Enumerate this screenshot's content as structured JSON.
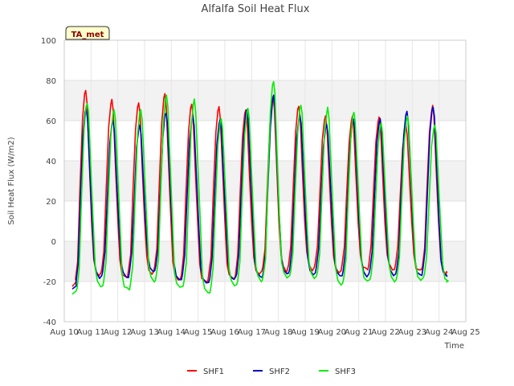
{
  "chart_data": {
    "type": "line",
    "title": "Alfalfa Soil Heat Flux",
    "xlabel": "Time",
    "ylabel": "Soil Heat Flux (W/m2)",
    "ylim": [
      -40,
      100
    ],
    "y_ticks": [
      -40,
      -20,
      0,
      20,
      40,
      60,
      80,
      100
    ],
    "y_tick_labels": [
      "-40",
      "-20",
      "0",
      "20",
      "40",
      "60",
      "80",
      "100"
    ],
    "xlim": [
      10,
      25
    ],
    "x_ticks": [
      10,
      11,
      12,
      13,
      14,
      15,
      16,
      17,
      18,
      19,
      20,
      21,
      22,
      23,
      24,
      25
    ],
    "x_tick_labels": [
      "Aug 10",
      "Aug 11",
      "Aug 12",
      "Aug 13",
      "Aug 14",
      "Aug 15",
      "Aug 16",
      "Aug 17",
      "Aug 18",
      "Aug 19",
      "Aug 20",
      "Aug 21",
      "Aug 22",
      "Aug 23",
      "Aug 24",
      "Aug 25"
    ],
    "x_start": 10.3,
    "x_end": 24.3,
    "grid": true,
    "background_bands": true,
    "badge": "TA_met",
    "legend_position": "bottom-center",
    "series": [
      {
        "name": "SHF1",
        "color": "#ff0000",
        "peak_x": [
          10.8,
          11.78,
          12.78,
          13.76,
          14.76,
          15.78,
          16.78,
          17.8,
          18.76,
          19.76,
          20.76,
          21.76,
          22.76,
          23.76
        ],
        "peaks": [
          75,
          70,
          69,
          73,
          68,
          67,
          65,
          72,
          67,
          62,
          62,
          62,
          58,
          67
        ],
        "troughs": [
          -22,
          -17,
          -18,
          -16,
          -19,
          -20,
          -19,
          -16,
          -15,
          -14,
          -15,
          -14,
          -14,
          -15,
          -16
        ]
      },
      {
        "name": "SHF2",
        "color": "#0000cc",
        "peak_x": [
          10.82,
          11.82,
          12.82,
          13.8,
          14.8,
          15.82,
          16.82,
          17.82,
          18.8,
          19.8,
          20.8,
          21.8,
          22.8,
          23.78
        ],
        "peaks": [
          66,
          60,
          58,
          64,
          62,
          60,
          65,
          72,
          63,
          58,
          61,
          61,
          65,
          67
        ],
        "troughs": [
          -23,
          -18,
          -18,
          -15,
          -19,
          -21,
          -19,
          -18,
          -17,
          -16,
          -17,
          -17,
          -17,
          -17,
          -18
        ]
      },
      {
        "name": "SHF3",
        "color": "#00ee00",
        "peak_x": [
          10.86,
          11.86,
          12.86,
          13.82,
          14.86,
          15.86,
          16.86,
          17.82,
          18.84,
          19.84,
          20.82,
          21.84,
          22.82,
          23.84
        ],
        "peaks": [
          69,
          66,
          66,
          73,
          70,
          61,
          66,
          80,
          68,
          66,
          64,
          58,
          62,
          58
        ],
        "troughs": [
          -26,
          -22,
          -24,
          -20,
          -23,
          -26,
          -22,
          -20,
          -18,
          -18,
          -22,
          -20,
          -20,
          -19,
          -20
        ]
      }
    ]
  }
}
